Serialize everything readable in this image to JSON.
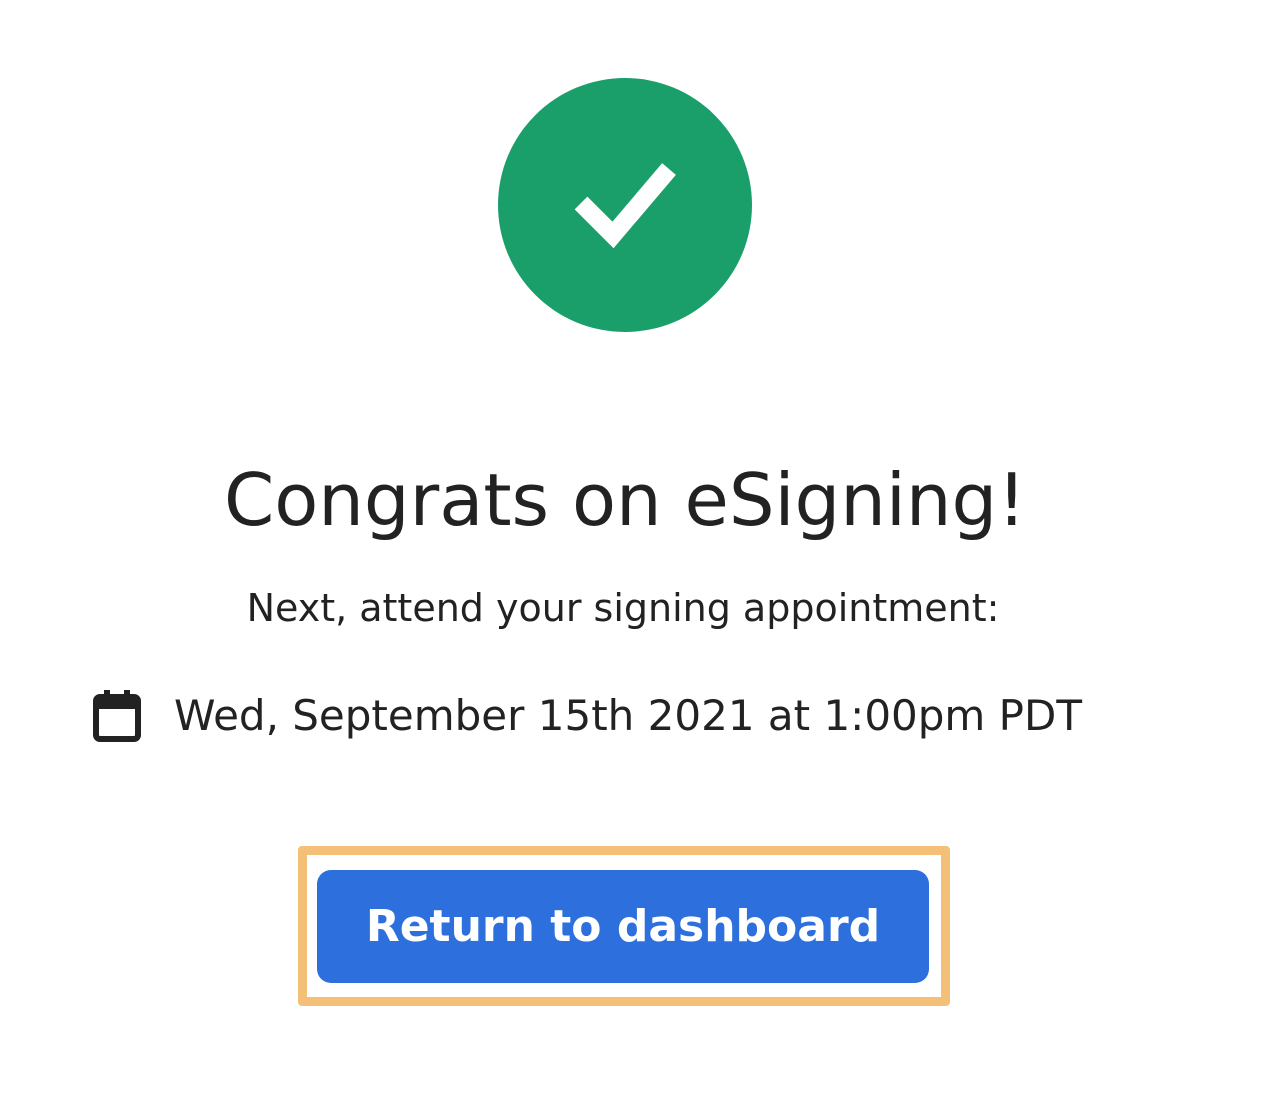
{
  "colors": {
    "success": "#1a9f6b",
    "primary": "#2d6fdc",
    "focus": "#f4c078",
    "text": "#222222"
  },
  "icons": {
    "status": "checkmark-icon",
    "date": "calendar-icon"
  },
  "confirmation": {
    "title": "Congrats on eSigning!",
    "subtitle": "Next, attend your signing appointment:",
    "appointment": "Wed, September 15th 2021 at 1:00pm PDT"
  },
  "actions": {
    "return_label": "Return to dashboard"
  }
}
